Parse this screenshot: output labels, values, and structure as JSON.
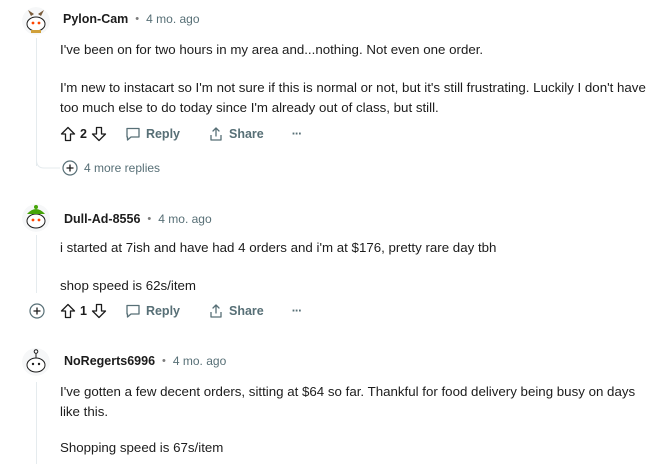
{
  "comments": [
    {
      "author": "Pylon-Cam",
      "separator": "•",
      "time": "4 mo. ago",
      "paragraphs": [
        "I've been on for two hours in my area and...nothing. Not even one order.",
        "I'm new to instacart so I'm not sure if this is normal or not, but it's still frustrating. Luckily I don't have too much else to do today since I'm already out of class, but still."
      ],
      "votes": "2",
      "reply_label": "Reply",
      "share_label": "Share",
      "more_label": "···",
      "more_replies": "4 more replies"
    },
    {
      "author": "Dull-Ad-8556",
      "separator": "•",
      "time": "4 mo. ago",
      "paragraphs": [
        "i started at 7ish and have had 4 orders and i'm at $176, pretty rare day tbh",
        "shop speed is 62s/item"
      ],
      "votes": "1",
      "reply_label": "Reply",
      "share_label": "Share",
      "more_label": "···"
    },
    {
      "author": "NoRegerts6996",
      "separator": "•",
      "time": "4 mo. ago",
      "paragraphs": [
        "I've gotten a few decent orders, sitting at $64 so far. Thankful for food delivery being busy on days like this.",
        "Shopping speed is 67s/item"
      ]
    }
  ],
  "colors": {
    "meta_gray": "#576f76",
    "thread_line": "#e5ebee",
    "avatar_green": "#46a508",
    "avatar_orange": "#ff4500"
  }
}
